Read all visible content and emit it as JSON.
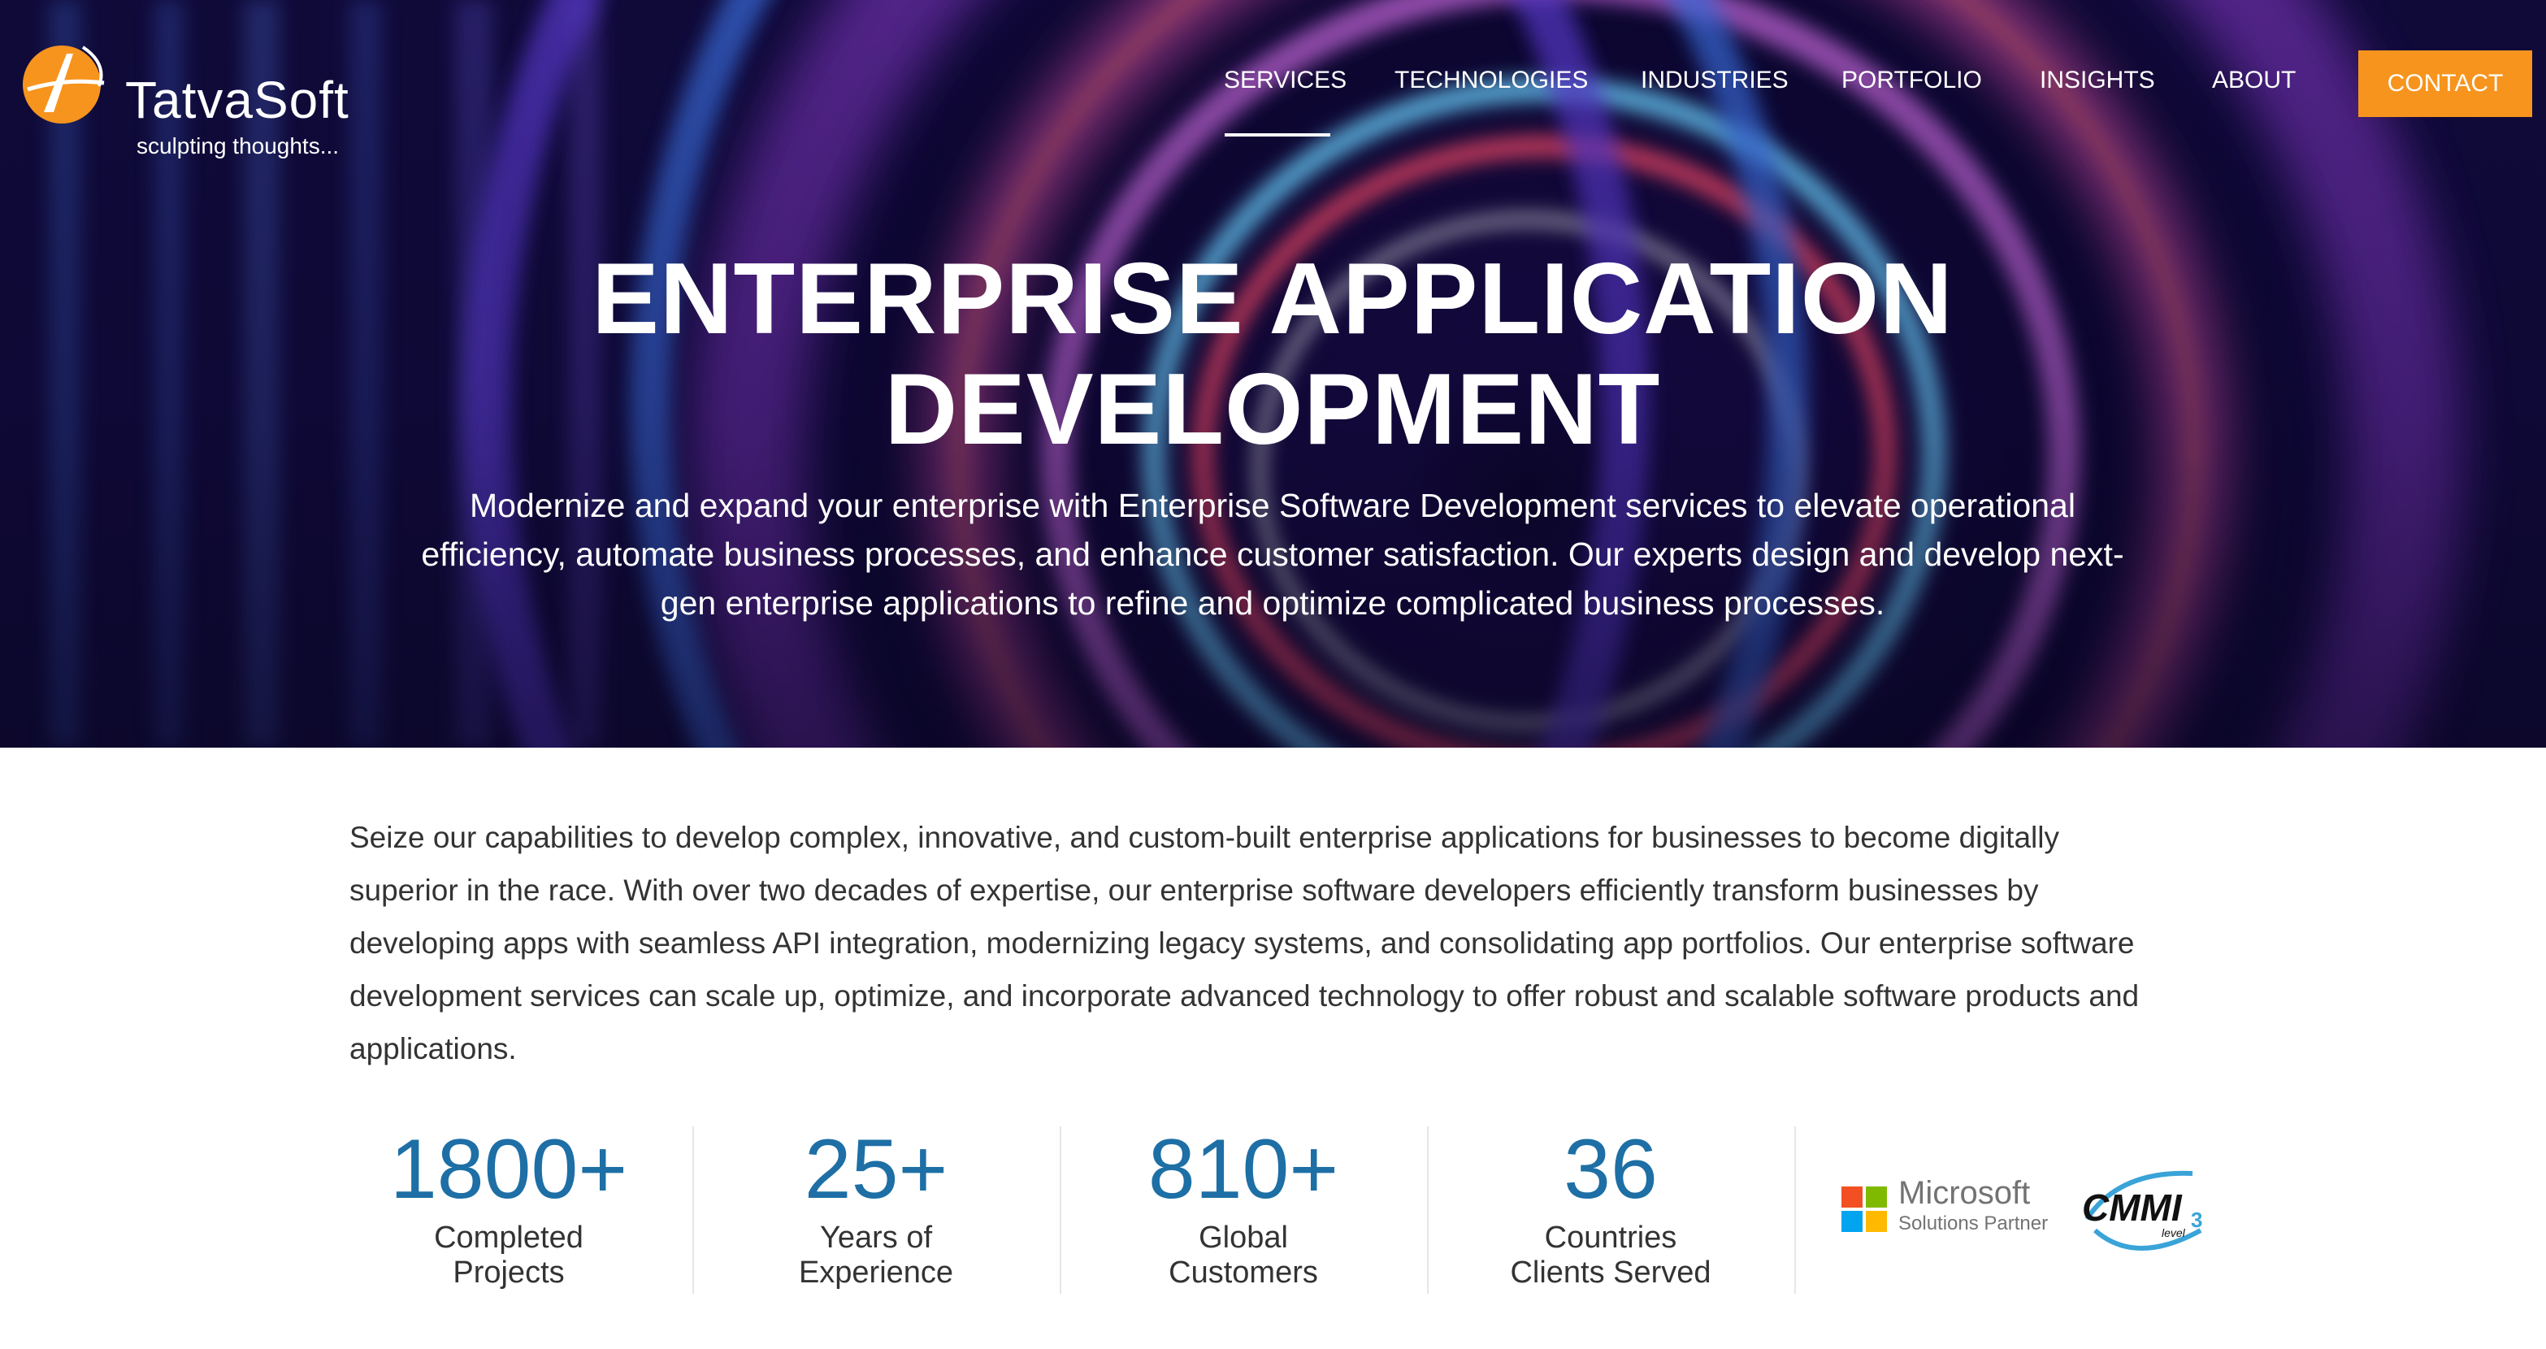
{
  "brand": {
    "name": "TatvaSoft",
    "tagline": "sculpting thoughts...",
    "logo_colors": {
      "orange": "#f7941d",
      "white": "#ffffff"
    }
  },
  "nav": {
    "items": [
      {
        "label": "SERVICES",
        "active": true
      },
      {
        "label": "TECHNOLOGIES",
        "active": false
      },
      {
        "label": "INDUSTRIES",
        "active": false
      },
      {
        "label": "PORTFOLIO",
        "active": false
      },
      {
        "label": "INSIGHTS",
        "active": false
      },
      {
        "label": "ABOUT",
        "active": false
      }
    ],
    "contact_label": "CONTACT",
    "contact_color": "#f7941d"
  },
  "hero": {
    "title_line1": "ENTERPRISE APPLICATION",
    "title_line2": "DEVELOPMENT",
    "subtitle_line1": "Modernize and expand your enterprise with Enterprise Software Development services to elevate operational",
    "subtitle_line2": "efficiency, automate business processes, and enhance customer satisfaction. Our experts design and develop next-",
    "subtitle_line3": "gen enterprise applications to refine and optimize complicated business processes."
  },
  "intro": {
    "line1": "Seize our capabilities to develop complex, innovative, and custom-built enterprise applications for businesses to become digitally",
    "line2": "superior in the race. With over two decades of expertise, our enterprise software developers efficiently transform businesses by",
    "line3": "developing apps with seamless API integration, modernizing legacy systems, and consolidating app portfolios. Our enterprise software",
    "line4": "development services can scale up, optimize, and incorporate advanced technology to offer robust and scalable software products and",
    "line5": "applications."
  },
  "stats": [
    {
      "value": "1800+",
      "label_line1": "Completed",
      "label_line2": "Projects"
    },
    {
      "value": "25+",
      "label_line1": "Years of",
      "label_line2": "Experience"
    },
    {
      "value": "810+",
      "label_line1": "Global",
      "label_line2": "Customers"
    },
    {
      "value": "36",
      "label_line1": "Countries",
      "label_line2": "Clients Served"
    }
  ],
  "stat_color": "#1d6fa5",
  "badges": {
    "microsoft_name": "Microsoft",
    "microsoft_sub": "Solutions Partner",
    "microsoft_colors": [
      "#f25022",
      "#7fba00",
      "#00a4ef",
      "#ffb900"
    ],
    "cmmi_text": "CMMI",
    "cmmi_level_word": "level",
    "cmmi_level_num": "3"
  }
}
